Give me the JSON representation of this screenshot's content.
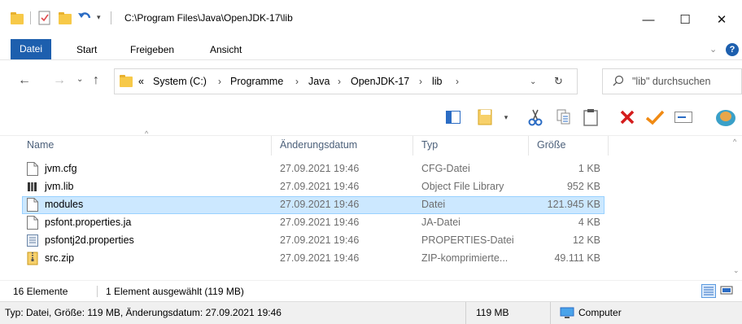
{
  "window": {
    "title": "C:\\Program Files\\Java\\OpenJDK-17\\lib",
    "minimize_glyph": "—",
    "maximize_glyph": "☐",
    "close_glyph": "✕"
  },
  "ribbon": {
    "tabs": [
      {
        "label": "Datei"
      },
      {
        "label": "Start"
      },
      {
        "label": "Freigeben"
      },
      {
        "label": "Ansicht"
      }
    ]
  },
  "address": {
    "overflow": "«",
    "crumbs": [
      "System (C:)",
      "Programme",
      "Java",
      "OpenJDK-17",
      "lib"
    ]
  },
  "search": {
    "placeholder": "\"lib\" durchsuchen"
  },
  "columns": {
    "name": "Name",
    "date": "Änderungsdatum",
    "type": "Typ",
    "size": "Größe"
  },
  "files": [
    {
      "name": "jvm.cfg",
      "date": "27.09.2021 19:46",
      "type": "CFG-Datei",
      "size": "1 KB",
      "icon": "file-icon"
    },
    {
      "name": "jvm.lib",
      "date": "27.09.2021 19:46",
      "type": "Object File Library",
      "size": "952 KB",
      "icon": "library-file-icon"
    },
    {
      "name": "modules",
      "date": "27.09.2021 19:46",
      "type": "Datei",
      "size": "121.945 KB",
      "icon": "file-icon",
      "selected": true
    },
    {
      "name": "psfont.properties.ja",
      "date": "27.09.2021 19:46",
      "type": "JA-Datei",
      "size": "4 KB",
      "icon": "file-icon"
    },
    {
      "name": "psfontj2d.properties",
      "date": "27.09.2021 19:46",
      "type": "PROPERTIES-Datei",
      "size": "12 KB",
      "icon": "properties-file-icon"
    },
    {
      "name": "src.zip",
      "date": "27.09.2021 19:46",
      "type": "ZIP-komprimierte...",
      "size": "49.111 KB",
      "icon": "zip-file-icon"
    }
  ],
  "status": {
    "count": "16 Elemente",
    "selection": "1 Element ausgewählt (119 MB)",
    "details": "Typ: Datei, Größe: 119 MB, Änderungsdatum: 27.09.2021 19:46",
    "size": "119 MB",
    "location": "Computer"
  },
  "colors": {
    "file_tab": "#1d5fae",
    "selection_bg": "#cce8ff",
    "selection_border": "#99d1ff",
    "delete_red": "#d41c1c",
    "check_orange": "#f08a13"
  }
}
